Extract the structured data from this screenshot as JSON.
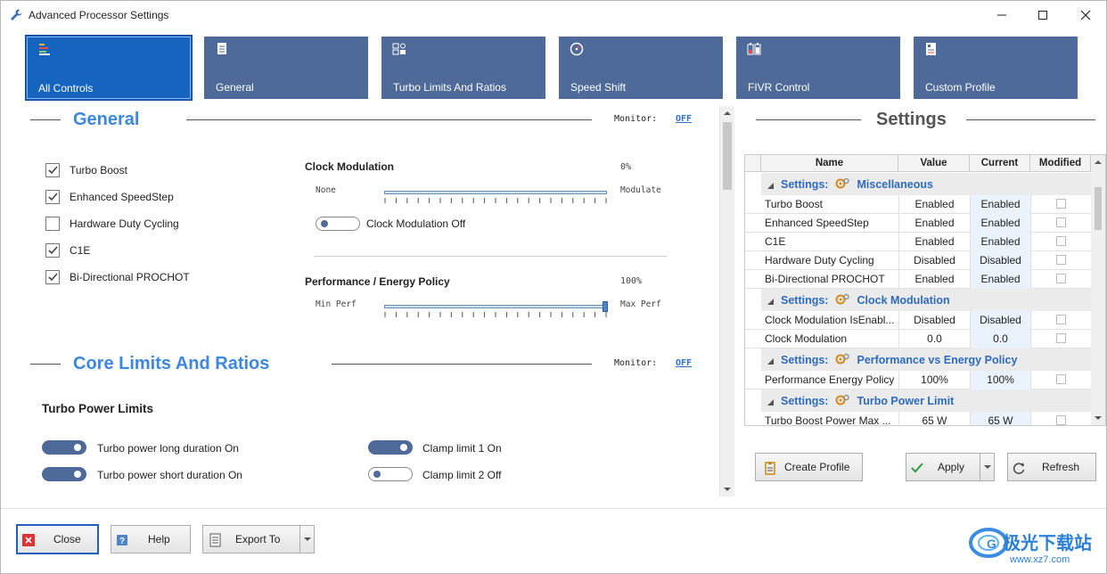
{
  "window": {
    "title": "Advanced Processor Settings",
    "controls": [
      "minimize",
      "maximize",
      "close"
    ]
  },
  "tabs": [
    {
      "label": "All Controls",
      "icon": "bars-chart-icon",
      "active": true
    },
    {
      "label": "General",
      "icon": "document-icon"
    },
    {
      "label": "Turbo Limits And Ratios",
      "icon": "settings-grid-icon"
    },
    {
      "label": "Speed Shift",
      "icon": "gauge-icon"
    },
    {
      "label": "FIVR Control",
      "icon": "battery-icon"
    },
    {
      "label": "Custom Profile",
      "icon": "profile-card-icon"
    }
  ],
  "general": {
    "title": "General",
    "monitor_label": "Monitor:",
    "monitor_value": "OFF",
    "checkboxes": [
      {
        "label": "Turbo Boost",
        "checked": true
      },
      {
        "label": "Enhanced SpeedStep",
        "checked": true
      },
      {
        "label": "Hardware Duty Cycling",
        "checked": false
      },
      {
        "label": "C1E",
        "checked": true
      },
      {
        "label": "Bi-Directional PROCHOT",
        "checked": true
      }
    ],
    "clock_modulation": {
      "title": "Clock Modulation",
      "value": "0%",
      "min_label": "None",
      "max_label": "Modulate",
      "level": 0,
      "toggle_label": "Clock Modulation Off",
      "toggle_on": false
    },
    "perf_policy": {
      "title": "Performance / Energy Policy",
      "value": "100%",
      "min_label": "Min Perf",
      "max_label": "Max Perf",
      "level": 1.0
    }
  },
  "core_limits": {
    "title": "Core Limits And Ratios",
    "monitor_label": "Monitor:",
    "monitor_value": "OFF",
    "turbo_power_title": "Turbo Power Limits",
    "toggles": [
      {
        "label": "Turbo power long duration On",
        "on": true
      },
      {
        "label": "Turbo power short duration On",
        "on": true
      },
      {
        "label": "Clamp limit 1 On",
        "on": true
      },
      {
        "label": "Clamp limit 2 Off",
        "on": false
      }
    ]
  },
  "settings": {
    "title": "Settings",
    "columns": [
      "Name",
      "Value",
      "Current",
      "Modified"
    ],
    "group_prefix": "Settings:",
    "groups": [
      {
        "name": "Miscellaneous",
        "rows": [
          {
            "name": "Turbo Boost",
            "value": "Enabled",
            "current": "Enabled"
          },
          {
            "name": "Enhanced SpeedStep",
            "value": "Enabled",
            "current": "Enabled"
          },
          {
            "name": "C1E",
            "value": "Enabled",
            "current": "Enabled"
          },
          {
            "name": "Hardware Duty Cycling",
            "value": "Disabled",
            "current": "Disabled"
          },
          {
            "name": "Bi-Directional PROCHOT",
            "value": "Enabled",
            "current": "Enabled"
          }
        ]
      },
      {
        "name": "Clock Modulation",
        "rows": [
          {
            "name": "Clock Modulation IsEnabl...",
            "value": "Disabled",
            "current": "Disabled"
          },
          {
            "name": "Clock Modulation",
            "value": "0.0",
            "current": "0.0"
          }
        ]
      },
      {
        "name": "Performance vs Energy Policy",
        "rows": [
          {
            "name": "Performance Energy Policy",
            "value": "100%",
            "current": "100%"
          }
        ]
      },
      {
        "name": "Turbo Power Limit",
        "rows": [
          {
            "name": "Turbo Boost Power Max ...",
            "value": "65 W",
            "current": "65 W"
          }
        ]
      }
    ],
    "buttons": {
      "create_profile": "Create Profile",
      "apply": "Apply",
      "refresh": "Refresh"
    }
  },
  "footer": {
    "close": "Close",
    "help": "Help",
    "export": "Export To"
  },
  "watermark": {
    "brand": "极光下载站",
    "url": "www.xz7.com"
  },
  "colors": {
    "tab": "#4e6a98",
    "tab_active": "#1565c0",
    "heading": "#3c87e0",
    "link": "#2c6fd6",
    "group_text": "#2d6bbf"
  }
}
